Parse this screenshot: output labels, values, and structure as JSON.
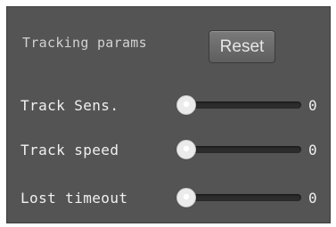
{
  "header": {
    "title": "Tracking params",
    "reset_label": "Reset"
  },
  "params": [
    {
      "label": "Track Sens.",
      "value": "0",
      "level": 0
    },
    {
      "label": "Track speed",
      "value": "0",
      "level": 0
    },
    {
      "label": "Lost timeout",
      "value": "0",
      "level": 0
    }
  ]
}
